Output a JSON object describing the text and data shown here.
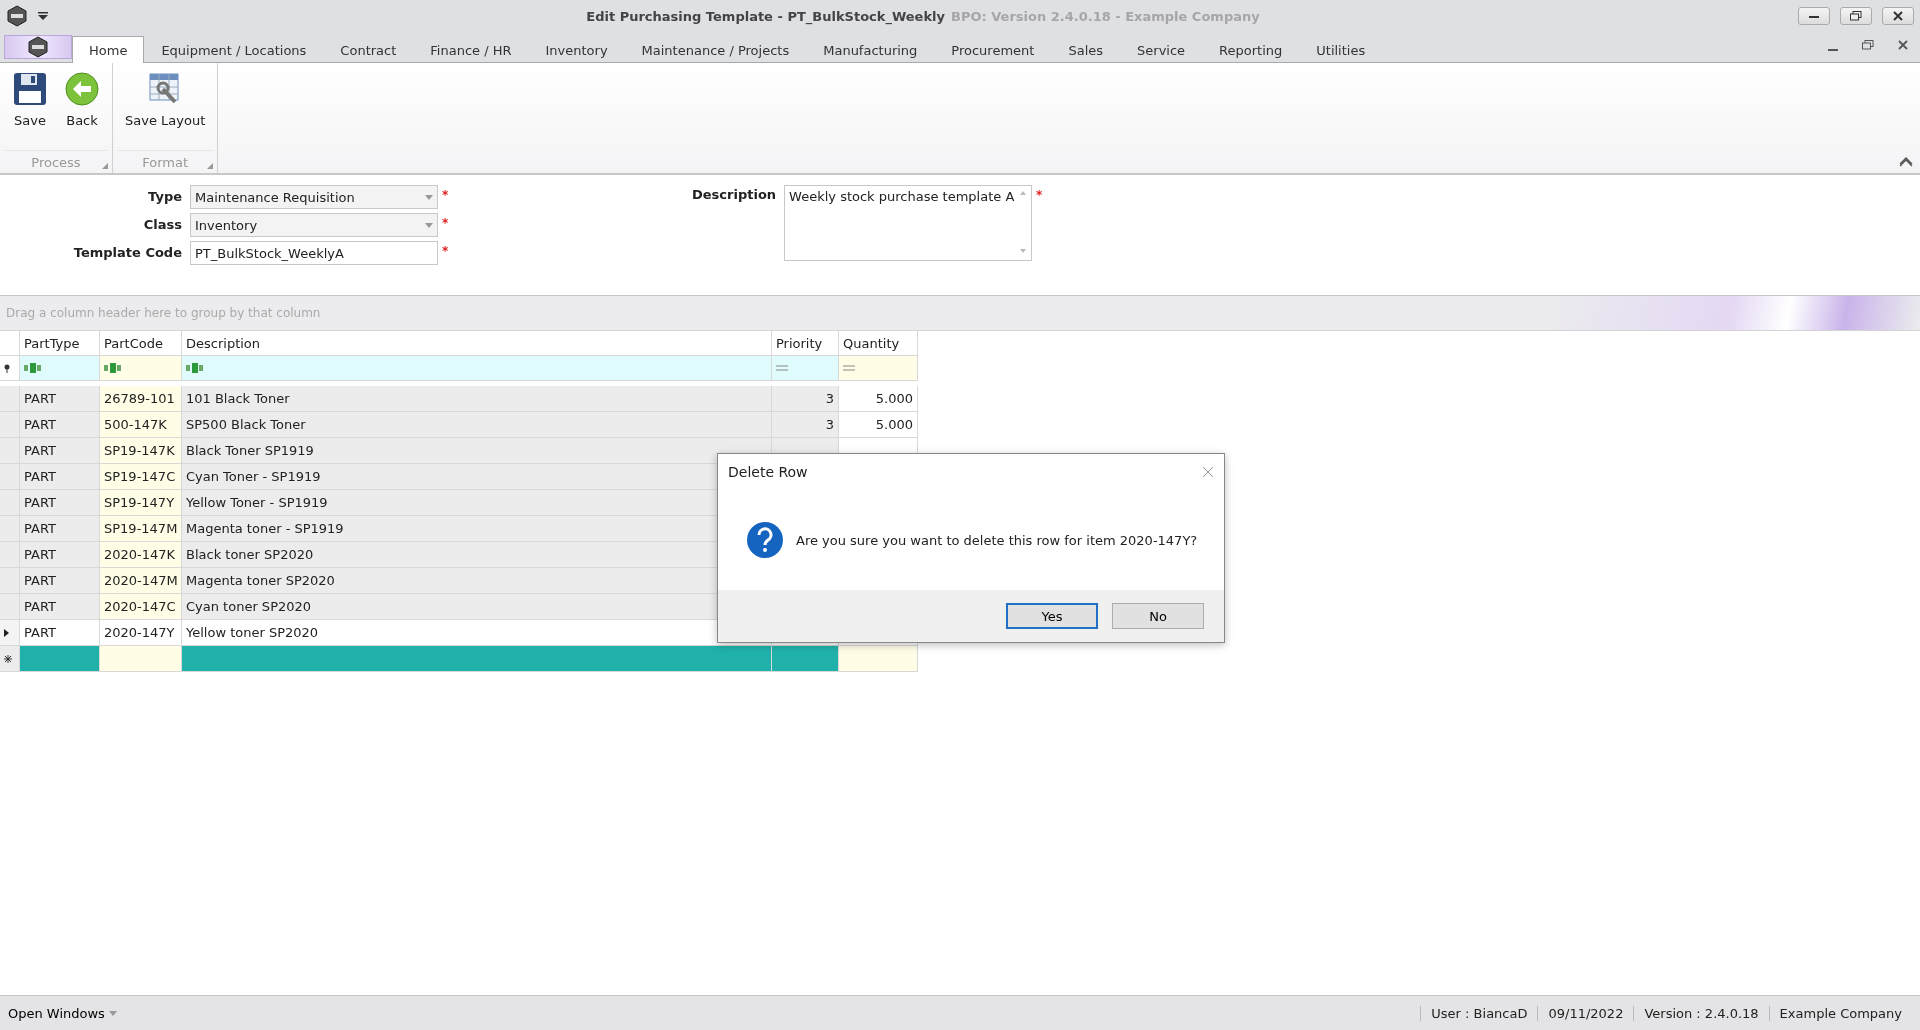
{
  "title_bar": {
    "title": "Edit Purchasing Template - PT_BulkStock_Weekly",
    "subtitle": "BPO: Version 2.4.0.18 - Example Company"
  },
  "ribbon_tabs": [
    {
      "label": "Home",
      "selected": true
    },
    {
      "label": "Equipment / Locations",
      "selected": false
    },
    {
      "label": "Contract",
      "selected": false
    },
    {
      "label": "Finance / HR",
      "selected": false
    },
    {
      "label": "Inventory",
      "selected": false
    },
    {
      "label": "Maintenance / Projects",
      "selected": false
    },
    {
      "label": "Manufacturing",
      "selected": false
    },
    {
      "label": "Procurement",
      "selected": false
    },
    {
      "label": "Sales",
      "selected": false
    },
    {
      "label": "Service",
      "selected": false
    },
    {
      "label": "Reporting",
      "selected": false
    },
    {
      "label": "Utilities",
      "selected": false
    }
  ],
  "ribbon_groups": [
    {
      "label": "Process",
      "buttons": [
        {
          "label": "Save",
          "kind": "save"
        },
        {
          "label": "Back",
          "kind": "back"
        }
      ]
    },
    {
      "label": "Format",
      "buttons": [
        {
          "label": "Save Layout",
          "kind": "layout"
        }
      ]
    }
  ],
  "form": {
    "fields": [
      {
        "label": "Type",
        "value": "Maintenance Requisition",
        "kind": "dropdown",
        "required_mark": "*"
      },
      {
        "label": "Class",
        "value": "Inventory",
        "kind": "dropdown",
        "required_mark": "*"
      },
      {
        "label": "Template Code",
        "value": "PT_BulkStock_WeeklyA",
        "kind": "text",
        "required_mark": "*"
      }
    ],
    "description": {
      "label": "Description",
      "value": "Weekly stock purchase template A",
      "required_mark": "*"
    }
  },
  "grid": {
    "group_panel_hint": "Drag a column header here to group by that column",
    "columns": [
      {
        "label": "PartType",
        "kind": "text"
      },
      {
        "label": "PartCode",
        "kind": "text"
      },
      {
        "label": "Description",
        "kind": "text"
      },
      {
        "label": "Priority",
        "kind": "number"
      },
      {
        "label": "Quantity",
        "kind": "number"
      }
    ],
    "rows": [
      {
        "part_type": "PART",
        "part_code": "26789-101",
        "description": "101 Black Toner",
        "priority": "3",
        "quantity": "5.000",
        "selected": false
      },
      {
        "part_type": "PART",
        "part_code": "500-147K",
        "description": "SP500 Black Toner",
        "priority": "3",
        "quantity": "5.000",
        "selected": false
      },
      {
        "part_type": "PART",
        "part_code": "SP19-147K",
        "description": "Black Toner SP1919",
        "selected": false
      },
      {
        "part_type": "PART",
        "part_code": "SP19-147C",
        "description": "Cyan Toner - SP1919",
        "selected": false
      },
      {
        "part_type": "PART",
        "part_code": "SP19-147Y",
        "description": "Yellow Toner - SP1919",
        "selected": false
      },
      {
        "part_type": "PART",
        "part_code": "SP19-147M",
        "description": "Magenta toner - SP1919",
        "selected": false
      },
      {
        "part_type": "PART",
        "part_code": "2020-147K",
        "description": "Black toner SP2020",
        "selected": false
      },
      {
        "part_type": "PART",
        "part_code": "2020-147M",
        "description": "Magenta toner SP2020",
        "selected": false
      },
      {
        "part_type": "PART",
        "part_code": "2020-147C",
        "description": "Cyan toner SP2020",
        "selected": false
      },
      {
        "part_type": "PART",
        "part_code": "2020-147Y",
        "description": "Yellow toner SP2020",
        "selected": true
      }
    ],
    "new_row": {
      "focused": true
    }
  },
  "dialog": {
    "title": "Delete Row",
    "message": "Are you sure you want to delete this row for item 2020-147Y?",
    "buttons": [
      {
        "label": "Yes",
        "default": true
      },
      {
        "label": "No",
        "default": false
      }
    ]
  },
  "status_bar": {
    "menu": "Open Windows",
    "items": [
      "User : BiancaD",
      "09/11/2022",
      "Version : 2.4.0.18",
      "Example Company"
    ]
  }
}
